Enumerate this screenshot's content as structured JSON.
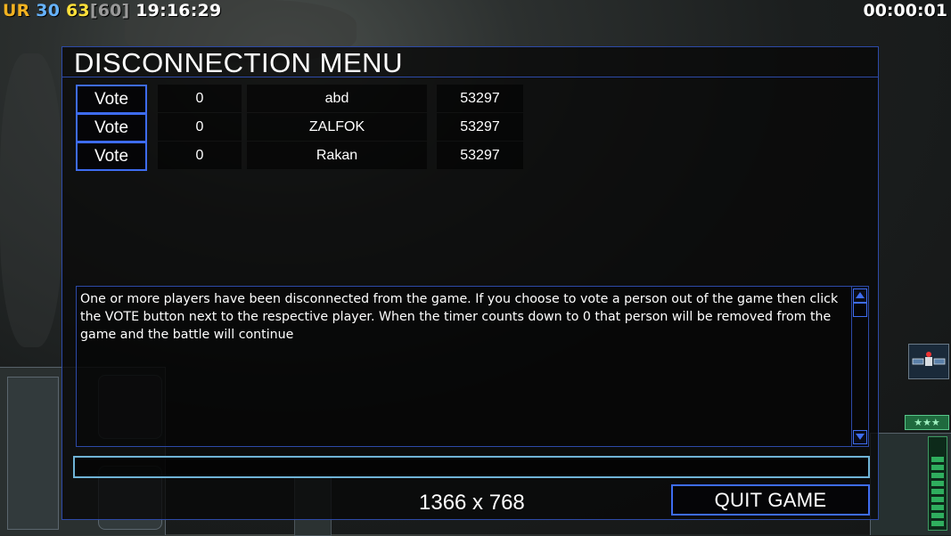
{
  "hud": {
    "faction": "UR",
    "value_a": "30",
    "value_b": "63",
    "value_cap": "[60]",
    "clock": "19:16:29",
    "timer": "00:00:01"
  },
  "dialog": {
    "title": "DISCONNECTION MENU",
    "players": [
      {
        "vote_label": "Vote",
        "count": "0",
        "name": "abd",
        "id": "53297"
      },
      {
        "vote_label": "Vote",
        "count": "0",
        "name": "ZALFOK",
        "id": "53297"
      },
      {
        "vote_label": "Vote",
        "count": "0",
        "name": "Rakan",
        "id": "53297"
      }
    ],
    "message": "One or more players have been disconnected from the game. If you choose to vote a person out of the game then click the VOTE button next to the respective player. When the timer counts down to 0 that person will be removed from the game and the battle will continue",
    "chat_value": "",
    "resolution": "1366 x 768",
    "quit_label": "QUIT GAME"
  },
  "side_hud": {
    "stars": "★★★"
  },
  "colors": {
    "accent_border": "#3e6cf0",
    "chat_border": "#6fb3d6",
    "faction": "#f2b221"
  }
}
